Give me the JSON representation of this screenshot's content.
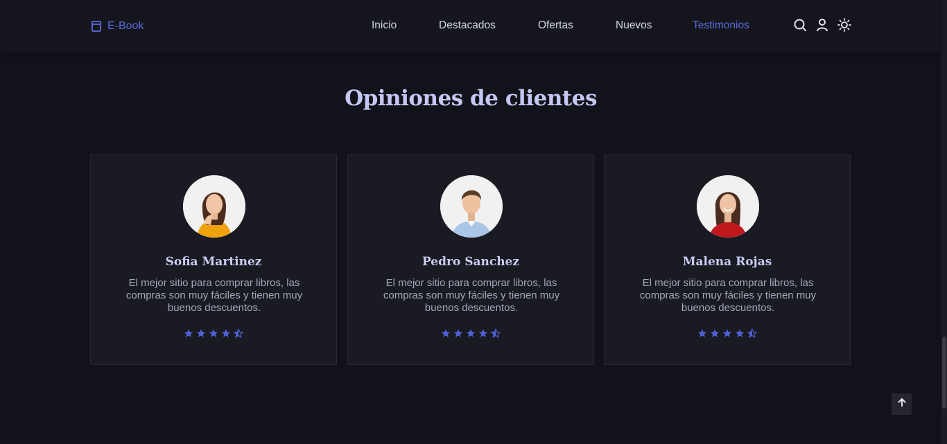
{
  "header": {
    "logo_text": "E-Book",
    "nav": [
      {
        "label": "Inicio",
        "active": false
      },
      {
        "label": "Destacados",
        "active": false
      },
      {
        "label": "Ofertas",
        "active": false
      },
      {
        "label": "Nuevos",
        "active": false
      },
      {
        "label": "Testimonios",
        "active": true
      }
    ],
    "icons": [
      "search-icon",
      "user-icon",
      "sun-icon"
    ]
  },
  "section": {
    "title": "Opiniones de clientes"
  },
  "testimonials": [
    {
      "name": "Sofia Martinez",
      "text": "El mejor sitio para comprar libros, las compras son muy fáciles y tienen muy buenos descuentos.",
      "rating": 4.5
    },
    {
      "name": "Pedro Sanchez",
      "text": "El mejor sitio para comprar libros, las compras son muy fáciles y tienen muy buenos descuentos.",
      "rating": 4.5
    },
    {
      "name": "Malena Rojas",
      "text": "El mejor sitio para comprar libros, las compras son muy fáciles y tienen muy buenos descuentos.",
      "rating": 4.5
    }
  ],
  "colors": {
    "background": "#12131a",
    "header": "#15161d",
    "accent": "#5a6cdb",
    "card": "#191a22",
    "title": "#c3c7f2",
    "star": "#4f62d6"
  }
}
